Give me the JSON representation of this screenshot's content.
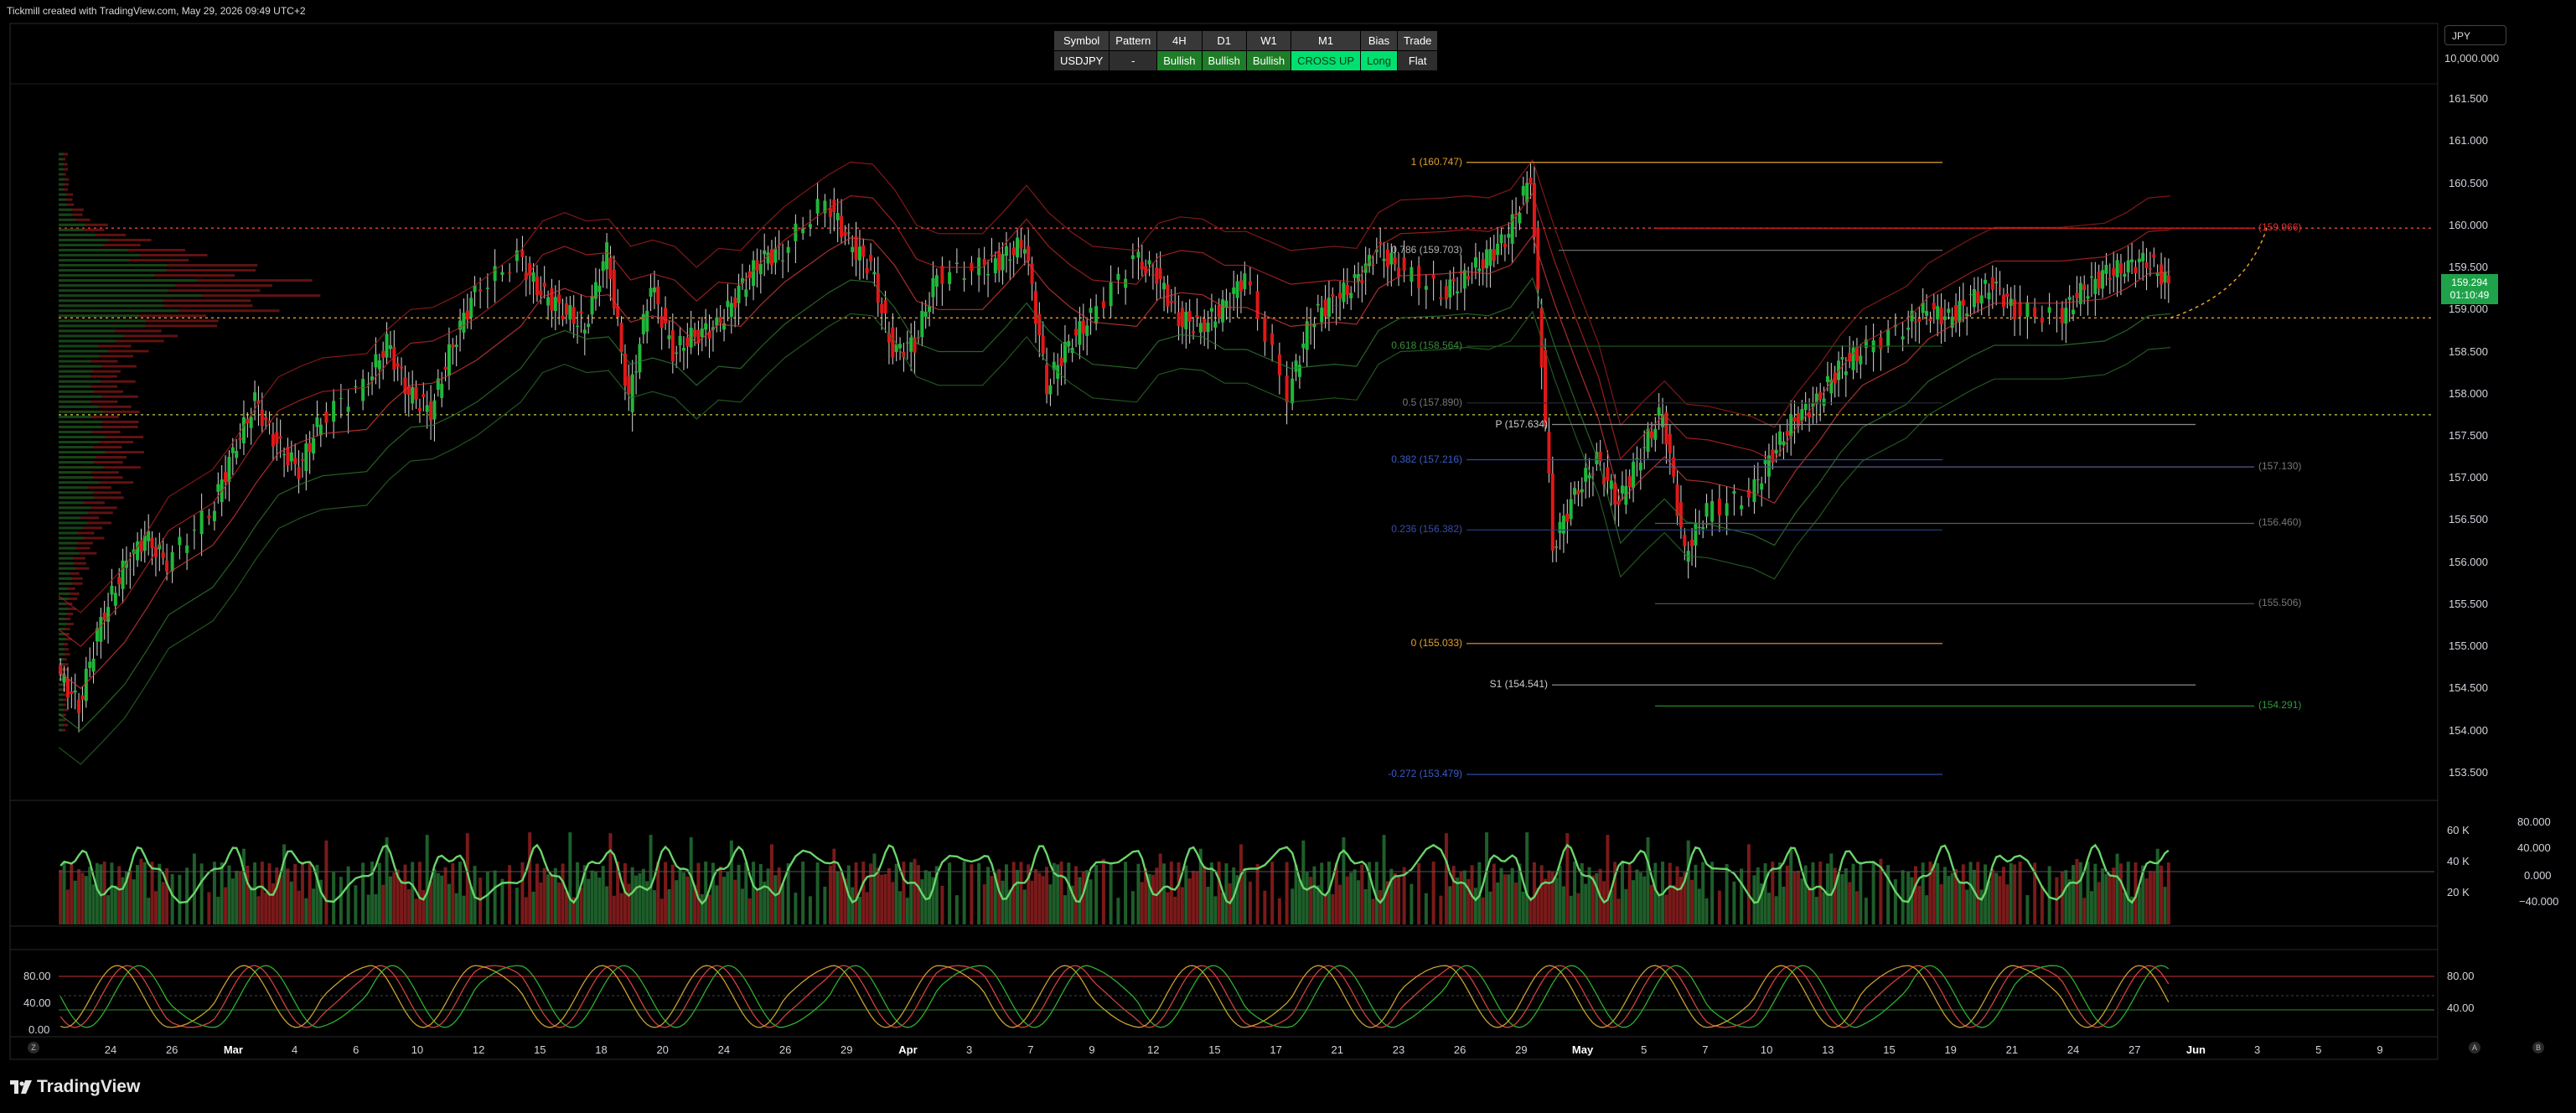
{
  "header": {
    "caption": "Tickmill created with TradingView.com, May 29, 2026 09:49 UTC+2"
  },
  "currency": {
    "label": "JPY",
    "top_value": "10,000.000"
  },
  "signal_table": {
    "headers": [
      "Symbol",
      "Pattern",
      "4H",
      "D1",
      "W1",
      "M1",
      "Bias",
      "Trade"
    ],
    "values": [
      "USDJPY",
      "-",
      "Bullish",
      "Bullish",
      "Bullish",
      "CROSS UP",
      "Long",
      "Flat"
    ]
  },
  "price_axis": {
    "ticks": [
      "161.500",
      "161.000",
      "160.500",
      "160.000",
      "159.500",
      "159.000",
      "158.500",
      "158.000",
      "157.500",
      "157.000",
      "156.500",
      "156.000",
      "155.500",
      "155.000",
      "154.500",
      "154.000",
      "153.500"
    ],
    "current_price": "159.294",
    "countdown": "01:10:49"
  },
  "fib_labels": [
    {
      "text": "1 (160.747)",
      "price": 160.747
    },
    {
      "text": "0.786 (159.703)",
      "price": 159.703
    },
    {
      "text": "0.618 (158.564)",
      "price": 158.564
    },
    {
      "text": "0.5 (157.890)",
      "price": 157.89
    },
    {
      "text": "0.382 (157.216)",
      "price": 157.216
    },
    {
      "text": "0.236 (156.382)",
      "price": 156.382
    },
    {
      "text": "0 (155.033)",
      "price": 155.033
    },
    {
      "text": "-0.272 (153.479)",
      "price": 153.479
    }
  ],
  "pivot_labels": [
    {
      "text": "P (157.634)",
      "price": 157.634
    },
    {
      "text": "S1 (154.541)",
      "price": 154.541
    }
  ],
  "right_levels": [
    {
      "text": "(159.966)",
      "price": 159.966
    },
    {
      "text": "(157.130)",
      "price": 157.13
    },
    {
      "text": "(156.460)",
      "price": 156.46
    },
    {
      "text": "(155.506)",
      "price": 155.506
    },
    {
      "text": "(154.291)",
      "price": 154.291
    }
  ],
  "volume_axis": {
    "left": [
      "60 K",
      "40 K",
      "20 K"
    ],
    "right": [
      "80.000",
      "40.000",
      "0.000",
      "−40.000"
    ]
  },
  "stoch_axis": {
    "left": [
      "80.00",
      "40.00",
      "0.00"
    ],
    "right": [
      "80.00",
      "40.00"
    ]
  },
  "time_axis": [
    {
      "t": "24",
      "b": false
    },
    {
      "t": "26",
      "b": false
    },
    {
      "t": "Mar",
      "b": true
    },
    {
      "t": "4",
      "b": false
    },
    {
      "t": "6",
      "b": false
    },
    {
      "t": "10",
      "b": false
    },
    {
      "t": "12",
      "b": false
    },
    {
      "t": "15",
      "b": false
    },
    {
      "t": "18",
      "b": false
    },
    {
      "t": "20",
      "b": false
    },
    {
      "t": "24",
      "b": false
    },
    {
      "t": "26",
      "b": false
    },
    {
      "t": "29",
      "b": false
    },
    {
      "t": "Apr",
      "b": true
    },
    {
      "t": "3",
      "b": false
    },
    {
      "t": "7",
      "b": false
    },
    {
      "t": "9",
      "b": false
    },
    {
      "t": "12",
      "b": false
    },
    {
      "t": "15",
      "b": false
    },
    {
      "t": "17",
      "b": false
    },
    {
      "t": "21",
      "b": false
    },
    {
      "t": "23",
      "b": false
    },
    {
      "t": "26",
      "b": false
    },
    {
      "t": "29",
      "b": false
    },
    {
      "t": "May",
      "b": true
    },
    {
      "t": "5",
      "b": false
    },
    {
      "t": "7",
      "b": false
    },
    {
      "t": "10",
      "b": false
    },
    {
      "t": "13",
      "b": false
    },
    {
      "t": "15",
      "b": false
    },
    {
      "t": "19",
      "b": false
    },
    {
      "t": "21",
      "b": false
    },
    {
      "t": "24",
      "b": false
    },
    {
      "t": "27",
      "b": false
    },
    {
      "t": "Jun",
      "b": true
    },
    {
      "t": "3",
      "b": false
    },
    {
      "t": "5",
      "b": false
    },
    {
      "t": "9",
      "b": false
    }
  ],
  "footer": {
    "brand": "TradingView"
  },
  "chart_data": {
    "type": "candlestick",
    "symbol": "USDJPY",
    "y_range": [
      153.2,
      161.7
    ],
    "date_range": [
      "2026-02-22",
      "2026-05-29"
    ],
    "series": [
      {
        "name": "close",
        "points": [
          [
            "2026-02-22",
            154.7
          ],
          [
            "2026-02-23",
            154.3
          ],
          [
            "2026-02-24",
            155.3
          ],
          [
            "2026-02-25",
            155.9
          ],
          [
            "2026-02-26",
            156.3
          ],
          [
            "2026-02-27",
            156.0
          ],
          [
            "2026-03-01",
            156.6
          ],
          [
            "2026-03-02",
            157.3
          ],
          [
            "2026-03-03",
            157.9
          ],
          [
            "2026-03-04",
            157.4
          ],
          [
            "2026-03-05",
            157.1
          ],
          [
            "2026-03-06",
            157.7
          ],
          [
            "2026-03-08",
            158.1
          ],
          [
            "2026-03-09",
            158.6
          ],
          [
            "2026-03-10",
            158.0
          ],
          [
            "2026-03-11",
            157.8
          ],
          [
            "2026-03-12",
            158.6
          ],
          [
            "2026-03-13",
            159.2
          ],
          [
            "2026-03-15",
            159.6
          ],
          [
            "2026-03-16",
            159.2
          ],
          [
            "2026-03-17",
            159.0
          ],
          [
            "2026-03-18",
            158.8
          ],
          [
            "2026-03-19",
            159.7
          ],
          [
            "2026-03-20",
            157.9
          ],
          [
            "2026-03-21",
            159.3
          ],
          [
            "2026-03-22",
            158.5
          ],
          [
            "2026-03-23",
            158.7
          ],
          [
            "2026-03-24",
            158.8
          ],
          [
            "2026-03-25",
            159.2
          ],
          [
            "2026-03-26",
            159.6
          ],
          [
            "2026-03-27",
            159.7
          ],
          [
            "2026-03-29",
            160.3
          ],
          [
            "2026-03-30",
            159.8
          ],
          [
            "2026-03-31",
            159.5
          ],
          [
            "2026-04-01",
            158.5
          ],
          [
            "2026-04-02",
            158.6
          ],
          [
            "2026-04-03",
            159.4
          ],
          [
            "2026-04-05",
            159.5
          ],
          [
            "2026-04-06",
            159.6
          ],
          [
            "2026-04-07",
            159.8
          ],
          [
            "2026-04-08",
            158.1
          ],
          [
            "2026-04-09",
            158.6
          ],
          [
            "2026-04-10",
            158.9
          ],
          [
            "2026-04-12",
            159.6
          ],
          [
            "2026-04-13",
            159.4
          ],
          [
            "2026-04-14",
            158.9
          ],
          [
            "2026-04-15",
            158.8
          ],
          [
            "2026-04-16",
            159.0
          ],
          [
            "2026-04-17",
            159.4
          ],
          [
            "2026-04-19",
            158.0
          ],
          [
            "2026-04-20",
            158.9
          ],
          [
            "2026-04-21",
            159.1
          ],
          [
            "2026-04-22",
            159.3
          ],
          [
            "2026-04-23",
            159.7
          ],
          [
            "2026-04-24",
            159.5
          ],
          [
            "2026-04-26",
            159.2
          ],
          [
            "2026-04-27",
            159.4
          ],
          [
            "2026-04-28",
            159.6
          ],
          [
            "2026-04-29",
            159.9
          ],
          [
            "2026-04-30",
            160.6
          ],
          [
            "2026-05-01",
            156.2
          ],
          [
            "2026-05-02",
            156.8
          ],
          [
            "2026-05-03",
            157.2
          ],
          [
            "2026-05-04",
            156.7
          ],
          [
            "2026-05-05",
            157.3
          ],
          [
            "2026-05-06",
            157.8
          ],
          [
            "2026-05-07",
            156.1
          ],
          [
            "2026-05-08",
            156.6
          ],
          [
            "2026-05-10",
            156.8
          ],
          [
            "2026-05-11",
            157.3
          ],
          [
            "2026-05-12",
            157.7
          ],
          [
            "2026-05-13",
            157.9
          ],
          [
            "2026-05-14",
            158.3
          ],
          [
            "2026-05-15",
            158.5
          ],
          [
            "2026-05-17",
            158.8
          ],
          [
            "2026-05-18",
            159.0
          ],
          [
            "2026-05-19",
            158.9
          ],
          [
            "2026-05-20",
            159.1
          ],
          [
            "2026-05-21",
            159.3
          ],
          [
            "2026-05-22",
            159.0
          ],
          [
            "2026-05-24",
            158.9
          ],
          [
            "2026-05-25",
            159.2
          ],
          [
            "2026-05-26",
            159.4
          ],
          [
            "2026-05-27",
            159.5
          ],
          [
            "2026-05-28",
            159.6
          ],
          [
            "2026-05-29",
            159.294
          ]
        ]
      }
    ]
  }
}
